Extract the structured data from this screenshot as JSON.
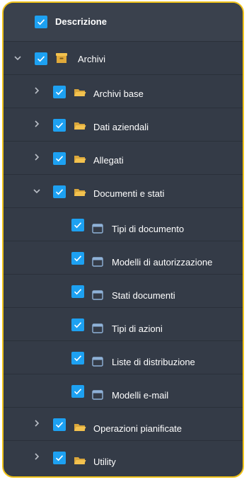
{
  "header": {
    "label": "Descrizione",
    "checked": true
  },
  "tree": {
    "archivi": {
      "label": "Archivi",
      "expanded": true,
      "icon": "archive-box-icon"
    },
    "archivi_base": {
      "label": "Archivi base",
      "expanded": false,
      "icon": "folder-icon"
    },
    "dati_aziendali": {
      "label": "Dati aziendali",
      "expanded": false,
      "icon": "folder-icon"
    },
    "allegati": {
      "label": "Allegati",
      "expanded": false,
      "icon": "folder-icon"
    },
    "documenti_e_stati": {
      "label": "Documenti e stati",
      "expanded": true,
      "icon": "folder-icon"
    },
    "tipi_di_documento": {
      "label": "Tipi di documento",
      "icon": "window-icon"
    },
    "modelli_di_autorizzazione": {
      "label": "Modelli di autorizzazione",
      "icon": "window-icon"
    },
    "stati_documenti": {
      "label": "Stati documenti",
      "icon": "window-icon"
    },
    "tipi_di_azioni": {
      "label": "Tipi di azioni",
      "icon": "window-icon"
    },
    "liste_di_distribuzione": {
      "label": "Liste di distribuzione",
      "icon": "window-icon"
    },
    "modelli_email": {
      "label": "Modelli e-mail",
      "icon": "window-icon"
    },
    "operazioni_pianificate": {
      "label": "Operazioni pianificate",
      "expanded": false,
      "icon": "folder-icon"
    },
    "utility": {
      "label": "Utility",
      "expanded": false,
      "icon": "folder-icon"
    }
  },
  "colors": {
    "panel_bg": "#343b47",
    "border": "#f0c319",
    "checkbox": "#1da1f2",
    "folder": "#f3c24f",
    "window_icon": "#8fb2d8",
    "chevron": "#b9bec6"
  }
}
